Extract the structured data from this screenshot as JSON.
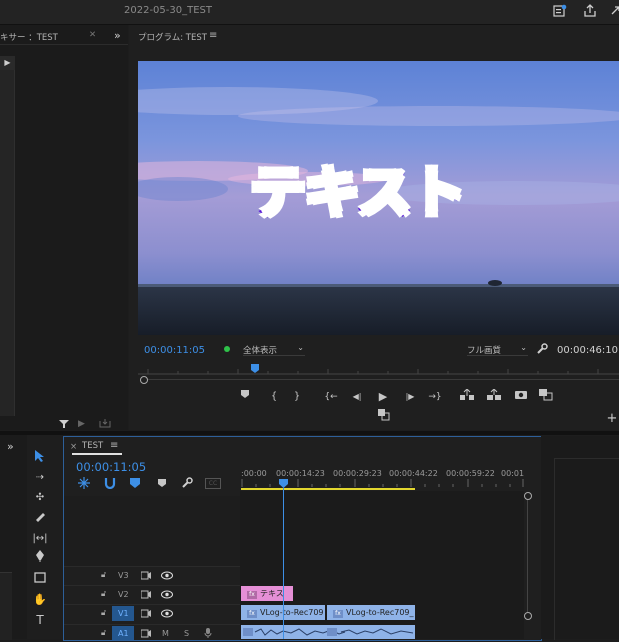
{
  "titlebar": {
    "document_title": "2022-05-30_TEST"
  },
  "left_panel": {
    "tab_label": "キサー ：TEST",
    "close": "✕",
    "expand": "»"
  },
  "program_monitor": {
    "title": "プログラム: TEST",
    "menu": "≡",
    "overlay_text": "テキスト",
    "current_timecode": "00:00:11:05",
    "zoom_label": "全体表示",
    "quality_label": "フル画質",
    "duration_timecode": "00:00:46:10"
  },
  "timeline": {
    "tab_label": "TEST",
    "close": "×",
    "menu": "≡",
    "timecode": "00:00:11:05",
    "ruler": [
      ":00:00",
      "00:00:14:23",
      "00:00:29:23",
      "00:00:44:22",
      "00:00:59:22",
      "00:01"
    ],
    "tracks": [
      {
        "name": "V3"
      },
      {
        "name": "V2"
      },
      {
        "name": "V1"
      },
      {
        "name": "A1",
        "m": "M",
        "s": "S"
      }
    ],
    "clips": {
      "v2_text": "テキス",
      "v1_a": "VLog-to-Rec709",
      "v1_b": "VLog-to-Rec709_"
    },
    "fx_badge": "fx"
  },
  "colors": {
    "accent": "#3d8fe6",
    "text_fill": "#ffffff",
    "text_stroke": "#5a17d8",
    "clip_pink": "#e58fd6",
    "clip_blue": "#8fb3e8",
    "work_area": "#e3d72f"
  }
}
